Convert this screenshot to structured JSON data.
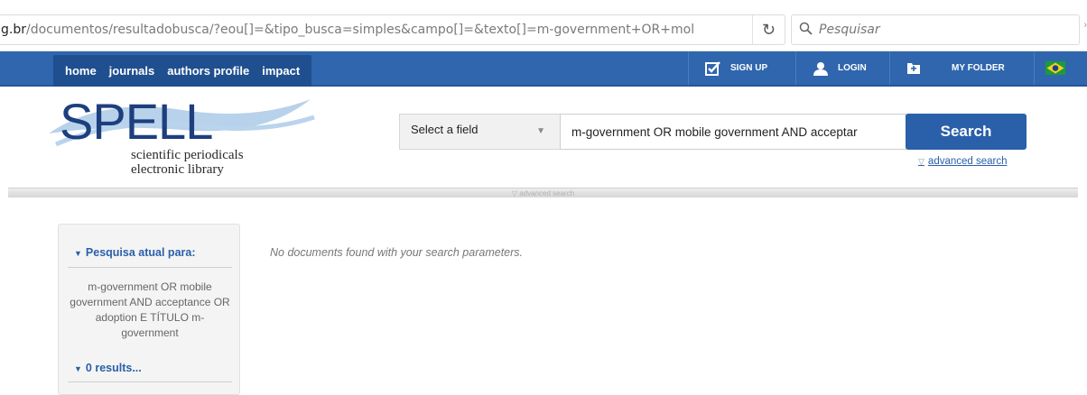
{
  "browser": {
    "url_domain": "g.br",
    "url_path": "/documentos/resultadobusca/?eou[]=&tipo_busca=simples&campo[]=&texto[]=m-government+OR+mol",
    "search_placeholder": "Pesquisar"
  },
  "nav": {
    "tabs": [
      {
        "label": "home"
      },
      {
        "label": "journals"
      },
      {
        "label": "authors profile"
      },
      {
        "label": "impact"
      }
    ],
    "signup": "SIGN UP",
    "login": "LOGIN",
    "folder": "MY FOLDER"
  },
  "logo": {
    "word": "SPELL",
    "line1": "scientific periodicals",
    "line2": "electronic library"
  },
  "search": {
    "field_select": "Select a field",
    "query": "m-government OR mobile government AND acceptar",
    "button": "Search",
    "advanced": "advanced search",
    "separator_label": "advanced search"
  },
  "sidebar": {
    "heading": "Pesquisa atual para:",
    "query_text": "m-government OR mobile government AND acceptance OR adoption E TÍTULO m-government",
    "results": "0 results..."
  },
  "main": {
    "message": "No documents found with your search parameters."
  },
  "colors": {
    "nav_blue": "#2f66ae",
    "tab_dark": "#1f4f8f",
    "link_blue": "#2a60a9"
  }
}
